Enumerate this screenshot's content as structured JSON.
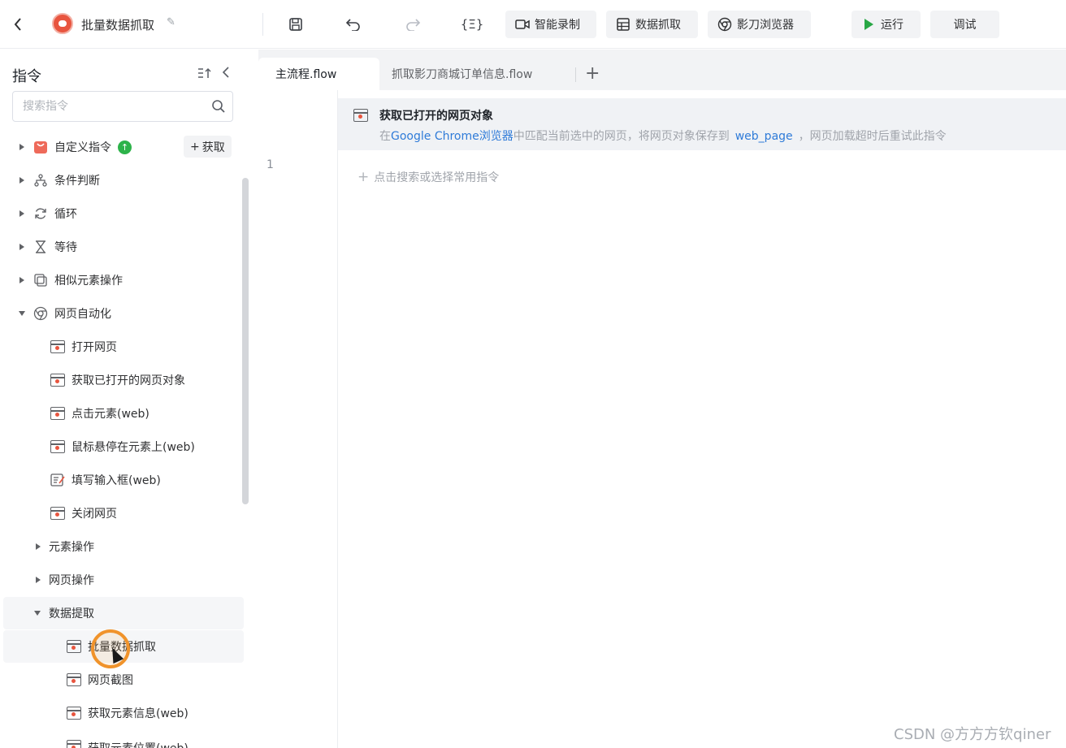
{
  "topbar": {
    "title": "批量数据抓取",
    "buttons": {
      "smart_record": "智能录制",
      "data_capture": "数据抓取",
      "browser": "影刀浏览器",
      "run": "运行",
      "debug": "调试"
    },
    "variables_icon_text": "{Ξ}"
  },
  "sidebar": {
    "title": "指令",
    "search_placeholder": "搜索指令",
    "get_button": "获取",
    "items": [
      {
        "label": "自定义指令",
        "icon": "custom-command-icon"
      },
      {
        "label": "条件判断",
        "icon": "branch-icon"
      },
      {
        "label": "循环",
        "icon": "loop-icon"
      },
      {
        "label": "等待",
        "icon": "hourglass-icon"
      },
      {
        "label": "相似元素操作",
        "icon": "copy-icon"
      },
      {
        "label": "网页自动化",
        "icon": "chrome-icon"
      },
      {
        "label": "打开网页",
        "icon": "webpage-icon"
      },
      {
        "label": "获取已打开的网页对象",
        "icon": "webpage-icon"
      },
      {
        "label": "点击元素(web)",
        "icon": "webpage-icon"
      },
      {
        "label": "鼠标悬停在元素上(web)",
        "icon": "webpage-icon"
      },
      {
        "label": "填写输入框(web)",
        "icon": "input-icon"
      },
      {
        "label": "关闭网页",
        "icon": "webpage-icon"
      },
      {
        "label": "元素操作",
        "icon": ""
      },
      {
        "label": "网页操作",
        "icon": ""
      },
      {
        "label": "数据提取",
        "icon": ""
      },
      {
        "label": "批量数据抓取",
        "icon": "webpage-icon"
      },
      {
        "label": "网页截图",
        "icon": "webpage-icon"
      },
      {
        "label": "获取元素信息(web)",
        "icon": "webpage-icon"
      },
      {
        "label": "获取元素位置(web)",
        "icon": "webpage-icon"
      }
    ]
  },
  "tabs": [
    {
      "label": "主流程.flow",
      "active": true
    },
    {
      "label": "抓取影刀商城订单信息.flow",
      "active": false
    }
  ],
  "editor": {
    "line_number": "1",
    "command_title": "获取已打开的网页对象",
    "desc_prefix": "在",
    "desc_browser": "Google Chrome浏览器",
    "desc_middle": "中匹配当前选中的网页，将网页对象保存到",
    "desc_variable": "web_page",
    "desc_suffix": "，网页加载超时后重试此指令",
    "add_hint": "点击搜索或选择常用指令"
  },
  "watermark": "CSDN @方方方钦qiner",
  "colors": {
    "accent": "#2f7bd8",
    "run_green": "#28a745",
    "cursor_ring": "#f0932b"
  }
}
